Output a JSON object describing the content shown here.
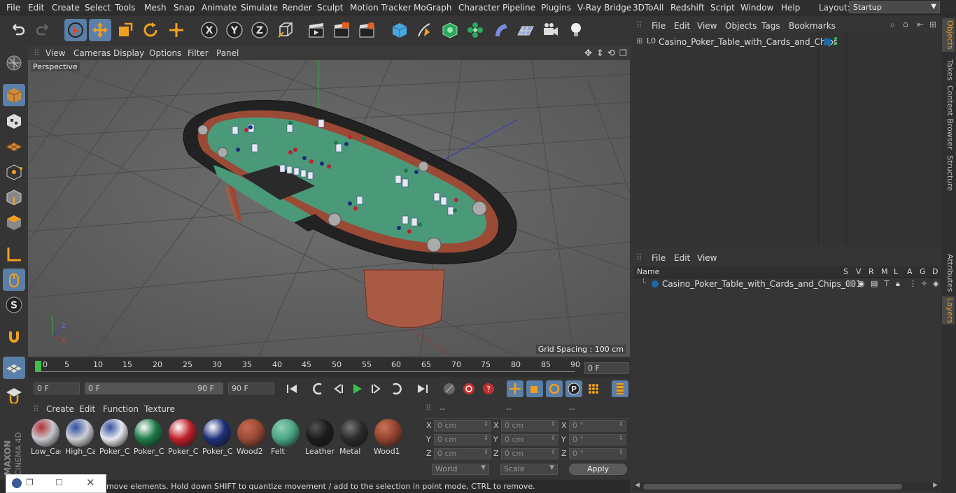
{
  "menubar": {
    "items": [
      "File",
      "Edit",
      "Create",
      "Select",
      "Tools",
      "Mesh",
      "Snap",
      "Animate",
      "Simulate",
      "Render",
      "Sculpt",
      "Motion Tracker",
      "MoGraph",
      "Character",
      "Pipeline",
      "Plugins",
      "V-Ray Bridge",
      "3DToAll",
      "Redshift",
      "Script",
      "Window",
      "Help"
    ],
    "layout_label": "Layout:",
    "layout_value": "Startup"
  },
  "viewport": {
    "menu": [
      "View",
      "Cameras",
      "Display",
      "Options",
      "Filter",
      "Panel"
    ],
    "camera_label": "Perspective",
    "grid_spacing": "Grid Spacing : 100 cm"
  },
  "timeline": {
    "ticks": [
      "0",
      "5",
      "10",
      "15",
      "20",
      "25",
      "30",
      "35",
      "40",
      "45",
      "50",
      "55",
      "60",
      "65",
      "70",
      "75",
      "80",
      "85",
      "90"
    ],
    "current_frame": "0 F"
  },
  "transport": {
    "start_field": "0 F",
    "range_start": "0 F",
    "range_end": "90 F",
    "end_field": "90 F"
  },
  "materials": {
    "menu": [
      "Create",
      "Edit",
      "Function",
      "Texture"
    ],
    "items": [
      {
        "label": "Low_Cas",
        "color": "#c8c8d0",
        "accent": "#b03030"
      },
      {
        "label": "High_Ca",
        "color": "#cfcfd6",
        "accent": "#3050a0"
      },
      {
        "label": "Poker_C",
        "color": "#e8e8ee",
        "accent": "#3050a0"
      },
      {
        "label": "Poker_C",
        "color": "#1d7a45",
        "accent": "#ffffff"
      },
      {
        "label": "Poker_C",
        "color": "#c0202a",
        "accent": "#ffffff"
      },
      {
        "label": "Poker_C",
        "color": "#1c2f7a",
        "accent": "#ffffff"
      },
      {
        "label": "Wood2",
        "color": "#9a4a35",
        "accent": "#c86a50"
      },
      {
        "label": "Felt",
        "color": "#4aa583",
        "accent": "#8fd1b4"
      },
      {
        "label": "Leather",
        "color": "#1c1c1c",
        "accent": "#555555"
      },
      {
        "label": "Metal",
        "color": "#2a2a2a",
        "accent": "#777777"
      },
      {
        "label": "Wood1",
        "color": "#93432d",
        "accent": "#c8755a"
      }
    ]
  },
  "coordinates": {
    "headers": [
      "--",
      "--",
      "--"
    ],
    "rows": [
      {
        "a": "X",
        "v1": "0 cm",
        "b": "X",
        "v2": "0 cm",
        "c": "X",
        "v3": "0 °"
      },
      {
        "a": "Y",
        "v1": "0 cm",
        "b": "Y",
        "v2": "0 cm",
        "c": "Y",
        "v3": "0 °"
      },
      {
        "a": "Z",
        "v1": "0 cm",
        "b": "Z",
        "v2": "0 cm",
        "c": "Z",
        "v3": "0 °"
      }
    ],
    "mode1": "World",
    "mode2": "Scale",
    "apply": "Apply"
  },
  "status": {
    "text": "move elements. Hold down SHIFT to quantize movement / add to the selection in point mode, CTRL to remove."
  },
  "objects_panel": {
    "menu": [
      "File",
      "Edit",
      "View",
      "Objects",
      "Tags",
      "Bookmarks"
    ],
    "object_name": "Casino_Poker_Table_with_Cards_and_Chips"
  },
  "layers_panel": {
    "menu": [
      "File",
      "Edit",
      "View"
    ],
    "columns": [
      "Name",
      "S",
      "V",
      "R",
      "M",
      "L",
      "A",
      "G",
      "D"
    ],
    "layer_name": "Casino_Poker_Table_with_Cards_and_Chips_001",
    "layer_color": "#1a6aa8"
  },
  "right_tabs": [
    "Objects",
    "Takes",
    "Content Browser",
    "Structure",
    "Attributes",
    "Layers"
  ],
  "brand": {
    "maxon": "MAXON",
    "product": "CINEMA 4D"
  }
}
